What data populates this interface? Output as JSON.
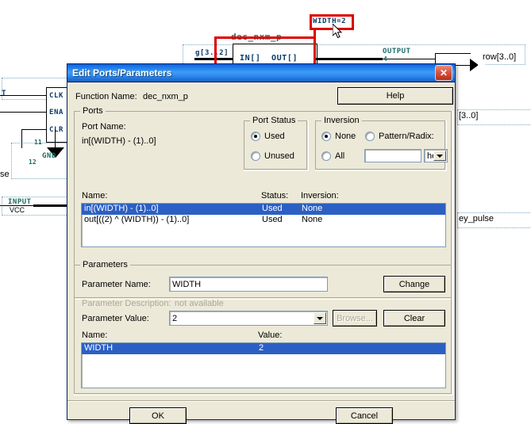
{
  "schematic": {
    "block_name": "dec_nxm_p",
    "block_in_port": "IN[]",
    "block_out_port": "OUT[]",
    "param_label": "WIDTH=2",
    "bus_label_left": "g[3..2]",
    "output_pin_type": "OUTPUT",
    "output_pin_name": "row[3..0]",
    "output_pin_num": "4",
    "pin_clk": "CLK",
    "pin_ena": "ENA",
    "pin_clr": "CLR",
    "gnd_label": "GND",
    "gnd_num": "12",
    "node_num_11": "11",
    "input_pin_type": "INPUT",
    "input_pin_name": "VCC",
    "partial_text_left": "se",
    "partial_text_right_top": "[3..0]",
    "partial_text_right_mid": "ey_pulse",
    "partial_text_topleft": "T"
  },
  "dialog": {
    "title": "Edit Ports/Parameters",
    "close_label": "✕",
    "function_name_label": "Function Name:",
    "function_name_value": "dec_nxm_p",
    "help_label": "Help",
    "ports": {
      "group_title": "Ports",
      "port_name_label": "Port Name:",
      "port_name_value": "in[(WIDTH) - (1)..0]",
      "col_name": "Name:",
      "col_status": "Status:",
      "col_inversion": "Inversion:",
      "rows": [
        {
          "name": "in[(WIDTH) - (1)..0]",
          "status": "Used",
          "inversion": "None",
          "selected": true
        },
        {
          "name": "out[((2) ^ (WIDTH)) - (1)..0]",
          "status": "Used",
          "inversion": "None",
          "selected": false
        }
      ]
    },
    "port_status": {
      "group_title": "Port Status",
      "options": [
        "Used",
        "Unused"
      ],
      "selected": "Used"
    },
    "inversion": {
      "group_title": "Inversion",
      "options": [
        "None",
        "Pattern/Radix:",
        "All"
      ],
      "selected": "None",
      "pattern_value": "",
      "radix_value": "hex"
    },
    "parameters": {
      "group_title": "Parameters",
      "param_name_label": "Parameter Name:",
      "param_name_value": "WIDTH",
      "param_desc_label": "Parameter Description:",
      "param_desc_value": "not available",
      "param_value_label": "Parameter Value:",
      "param_value_value": "2",
      "change_label": "Change",
      "browse_label": "Browse...",
      "clear_label": "Clear",
      "col_name": "Name:",
      "col_value": "Value:",
      "rows": [
        {
          "name": "WIDTH",
          "value": "2",
          "selected": true
        }
      ]
    },
    "ok_label": "OK",
    "cancel_label": "Cancel"
  },
  "colors": {
    "title_gradient_start": "#0a5fd4",
    "title_gradient_end": "#165fc4",
    "dialog_face": "#ece9d8",
    "selection_blue": "#2b5fc4",
    "selection_red": "#dd0000",
    "schematic_label_blue": "#0a3a6b",
    "schematic_label_teal": "#1d6b66"
  }
}
